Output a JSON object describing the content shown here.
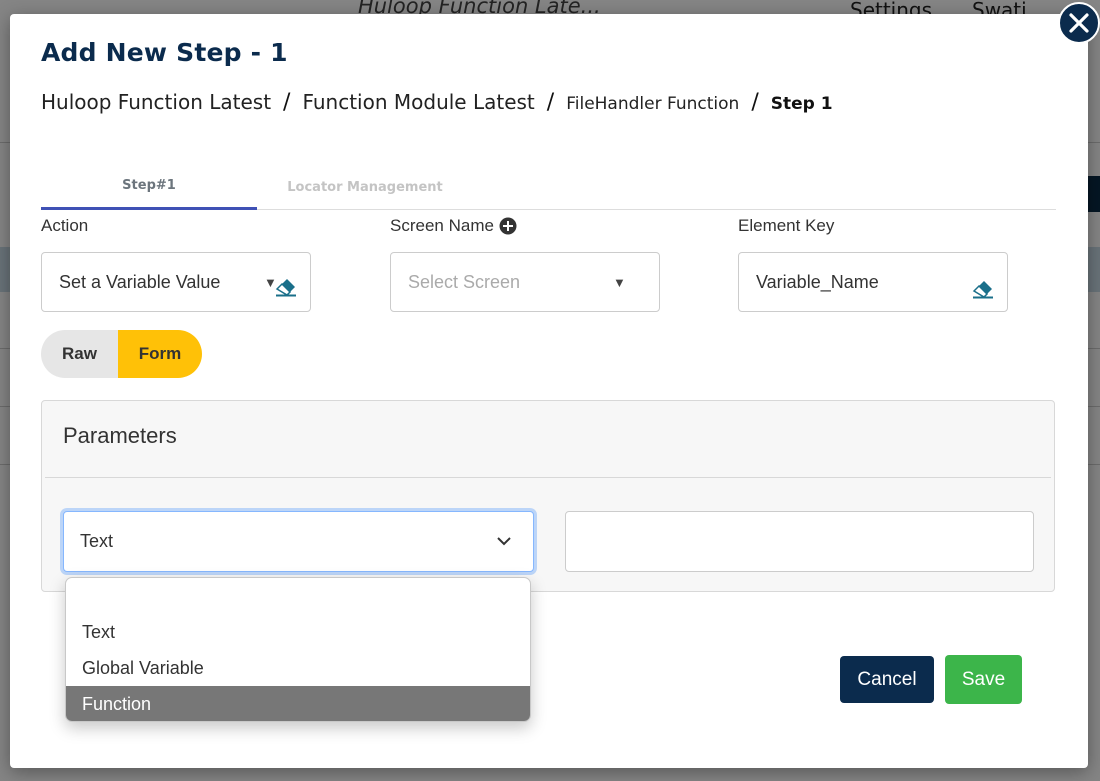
{
  "background": {
    "header_title": "Huloop Function Late...",
    "settings_label": "Settings",
    "user_label": "Swati"
  },
  "modal": {
    "title": "Add New Step - 1",
    "close_icon": "close-icon",
    "breadcrumb": [
      {
        "label": "Huloop Function Latest"
      },
      {
        "label": "Function Module Latest"
      },
      {
        "label": "FileHandler Function"
      },
      {
        "label": "Step 1"
      }
    ],
    "breadcrumb_separator": "/"
  },
  "tabs": [
    {
      "label": "Step#1",
      "active": true
    },
    {
      "label": "Locator Management",
      "active": false
    }
  ],
  "fields": {
    "action": {
      "label": "Action",
      "value": "Set a Variable Value"
    },
    "screen_name": {
      "label": "Screen Name",
      "placeholder": "Select Screen",
      "add_icon": "plus-circle-icon"
    },
    "element_key": {
      "label": "Element Key",
      "value": "Variable_Name"
    }
  },
  "mode_toggle": {
    "options": [
      "Raw",
      "Form"
    ],
    "selected": "Form"
  },
  "parameters": {
    "title": "Parameters",
    "type_select": {
      "value": "Text"
    },
    "value_input": {
      "value": ""
    }
  },
  "dropdown": {
    "options": [
      "",
      "Text",
      "Global Variable",
      "Function"
    ],
    "highlighted": "Function"
  },
  "footer": {
    "cancel_label": "Cancel",
    "save_label": "Save"
  },
  "colors": {
    "primary_navy": "#0b2b4d",
    "accent_yellow": "#ffc107",
    "save_green": "#3cb54a",
    "tab_underline": "#3f51b5",
    "eraser_teal": "#1a6f8a"
  }
}
